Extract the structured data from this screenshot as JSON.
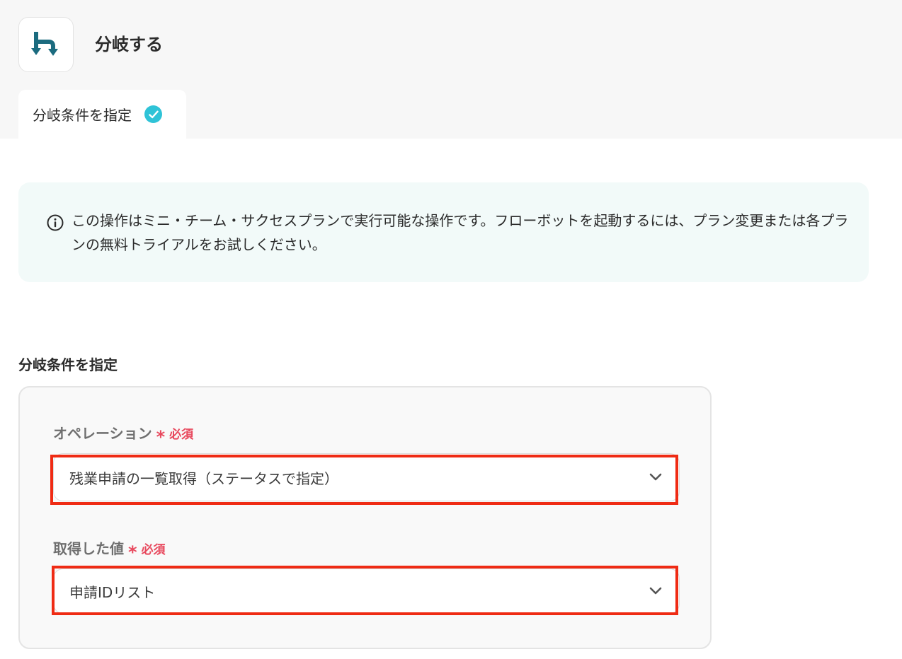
{
  "app": {
    "title": "分岐する",
    "icon": "branch-icon",
    "icon_color": "#1b6b7f"
  },
  "tabs": [
    {
      "label": "分岐条件を指定",
      "status": "complete",
      "status_icon": "check-circle-icon",
      "status_color": "#2fc3d7"
    }
  ],
  "notice": {
    "icon": "info-icon",
    "text": "この操作はミニ・チーム・サクセスプランで実行可能な操作です。フローボットを起動するには、プラン変更または各プランの無料トライアルをお試しください。"
  },
  "section": {
    "title": "分岐条件を指定"
  },
  "fields": [
    {
      "label": "オペレーション",
      "required_mark": "*",
      "required_text": "必須",
      "value": "残業申請の一覧取得（ステータスで指定）"
    },
    {
      "label": "取得した値",
      "required_mark": "*",
      "required_text": "必須",
      "value": "申請IDリスト"
    }
  ],
  "colors": {
    "accent": "#2fc3d7",
    "required": "#e8485d",
    "highlight": "#ef2b14",
    "notice_bg": "#f2faf9"
  }
}
